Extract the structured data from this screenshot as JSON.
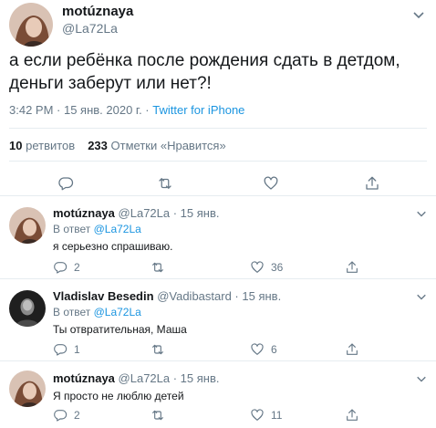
{
  "main_tweet": {
    "display_name": "motúznaya",
    "handle": "@La72La",
    "text": "а если ребёнка после рождения сдать в детдом, деньги заберут или нет?!",
    "time": "3:42 PM · 15 янв. 2020 г. · ",
    "source": "Twitter for iPhone",
    "retweets_count": "10",
    "retweets_label": "ретвитов",
    "likes_count": "233",
    "likes_label": "Отметки «Нравится»"
  },
  "replies": [
    {
      "display_name": "motúznaya",
      "handle": "@La72La",
      "date": "15 янв.",
      "in_reply_prefix": "В ответ ",
      "in_reply_mention": "@La72La",
      "text": "я серьезно спрашиваю.",
      "reply_count": "2",
      "retweet_count": "",
      "like_count": "36"
    },
    {
      "display_name": "Vladislav Besedin",
      "handle": "@Vadibastard",
      "date": "15 янв.",
      "in_reply_prefix": "В ответ ",
      "in_reply_mention": "@La72La",
      "text": "Ты отвратительная, Маша",
      "reply_count": "1",
      "retweet_count": "",
      "like_count": "6"
    },
    {
      "display_name": "motúznaya",
      "handle": "@La72La",
      "date": "15 янв.",
      "text": "Я просто не люблю детей",
      "reply_count": "2",
      "retweet_count": "",
      "like_count": "11"
    }
  ],
  "colors": {
    "text": "#14171a",
    "muted": "#657786",
    "link": "#1b95e0",
    "divider": "#e6ecf0"
  },
  "icons": [
    "chevron-down-icon",
    "reply-icon",
    "retweet-icon",
    "like-icon",
    "share-icon"
  ]
}
